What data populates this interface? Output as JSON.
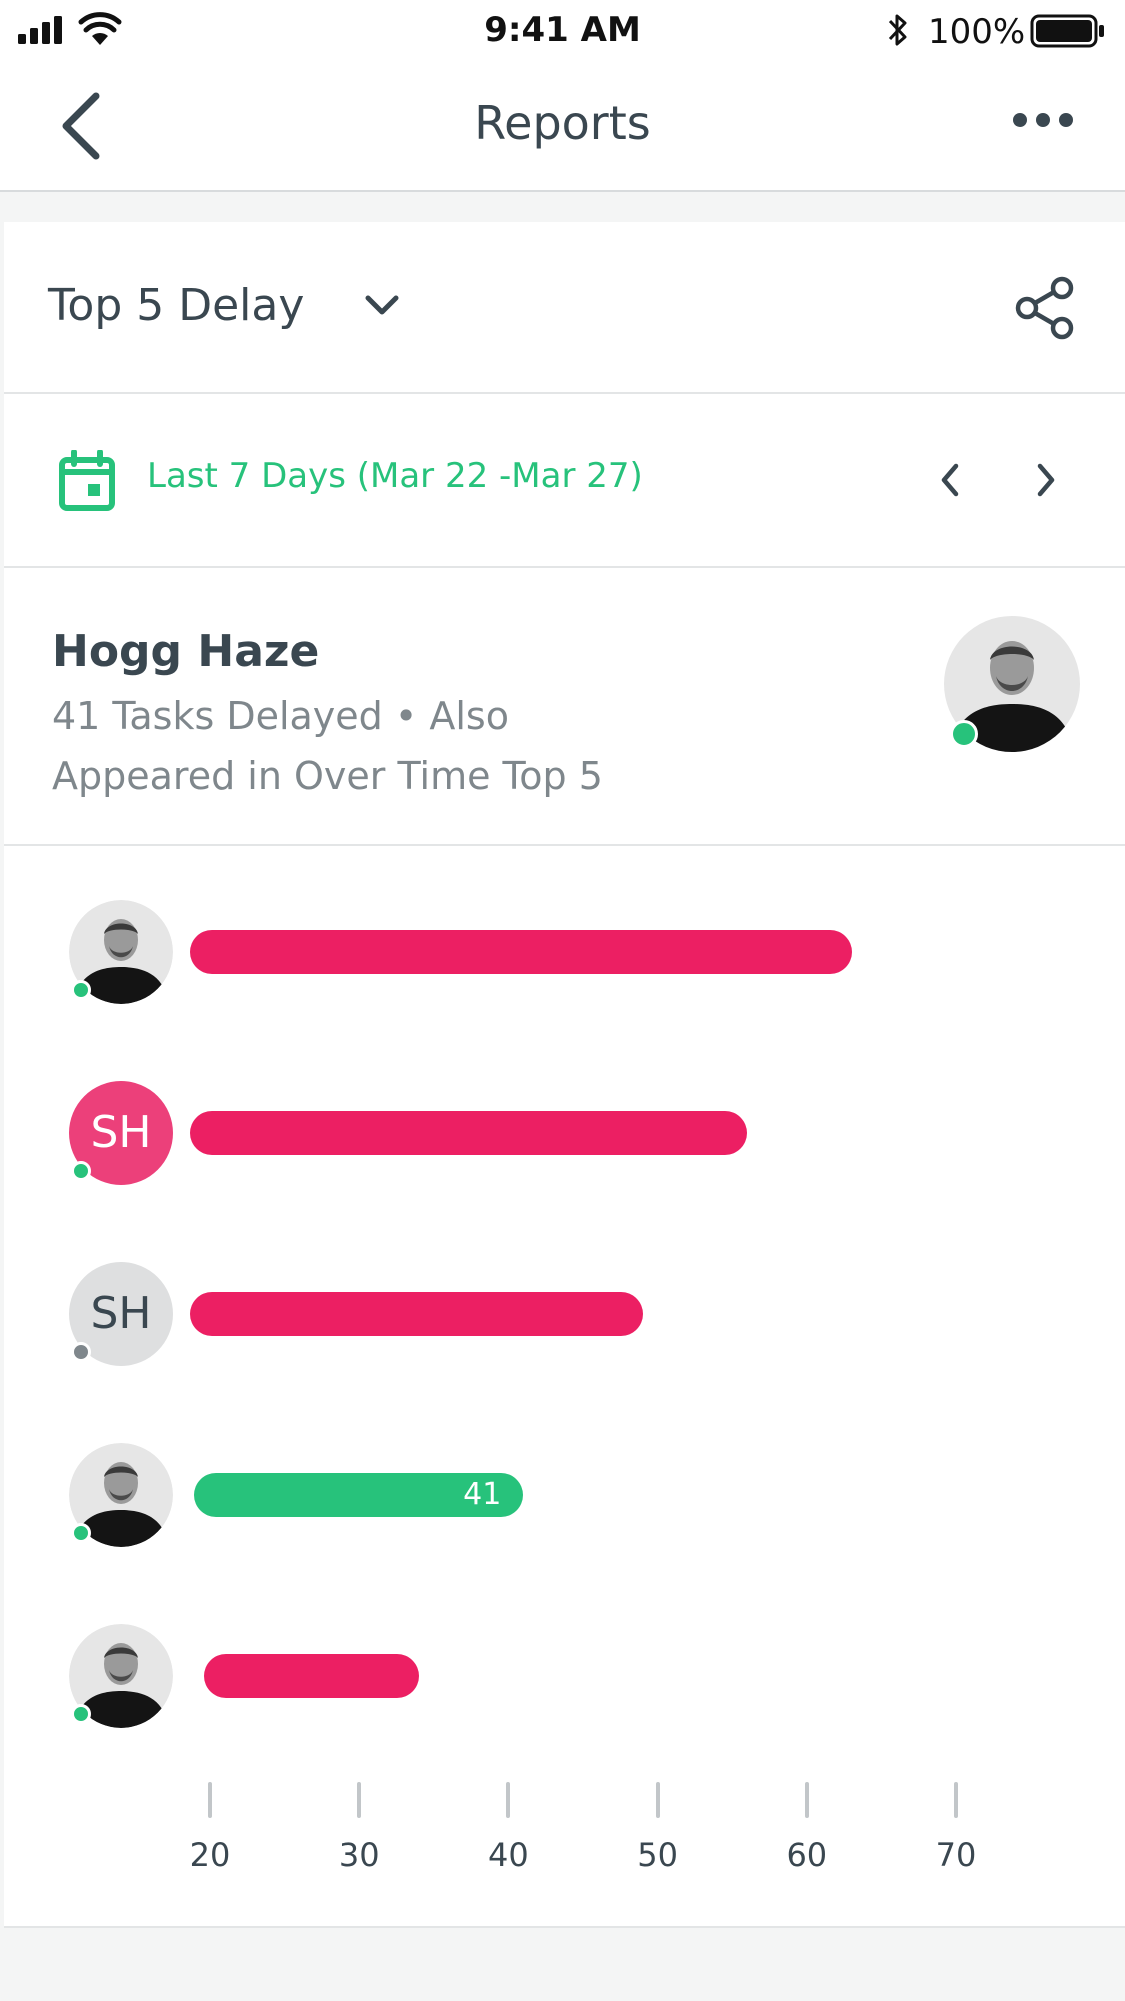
{
  "status_bar": {
    "time": "9:41 AM",
    "battery": "100%"
  },
  "nav": {
    "title": "Reports"
  },
  "report": {
    "title": "Top 5 Delay"
  },
  "date_range": {
    "label": "Last 7 Days (Mar 22 -Mar 27)"
  },
  "selected_person": {
    "name": "Hogg Haze",
    "subtitle": "41 Tasks Delayed • Also Appeared in Over Time Top 5",
    "online": true
  },
  "colors": {
    "accent_green": "#27c27b",
    "bar_pink": "#ec1f63",
    "avatar_pink": "#ec407a",
    "offline_gray": "#7f878c"
  },
  "chart_data": {
    "type": "bar",
    "orientation": "horizontal",
    "xlim": [
      20,
      70
    ],
    "x_ticks": [
      20,
      30,
      40,
      50,
      60,
      70
    ],
    "rows": [
      {
        "avatar": "photo",
        "initials": "",
        "online": true,
        "value": 63,
        "label": "",
        "highlighted": false
      },
      {
        "avatar": "initials-pink",
        "initials": "SH",
        "online": true,
        "value": 56,
        "label": "",
        "highlighted": false
      },
      {
        "avatar": "initials-gray",
        "initials": "SH",
        "online": false,
        "value": 49,
        "label": "",
        "highlighted": false
      },
      {
        "avatar": "photo",
        "initials": "",
        "online": true,
        "value": 41,
        "label": "41",
        "highlighted": true
      },
      {
        "avatar": "photo",
        "initials": "",
        "online": true,
        "value": 34,
        "label": "",
        "highlighted": false
      }
    ]
  }
}
